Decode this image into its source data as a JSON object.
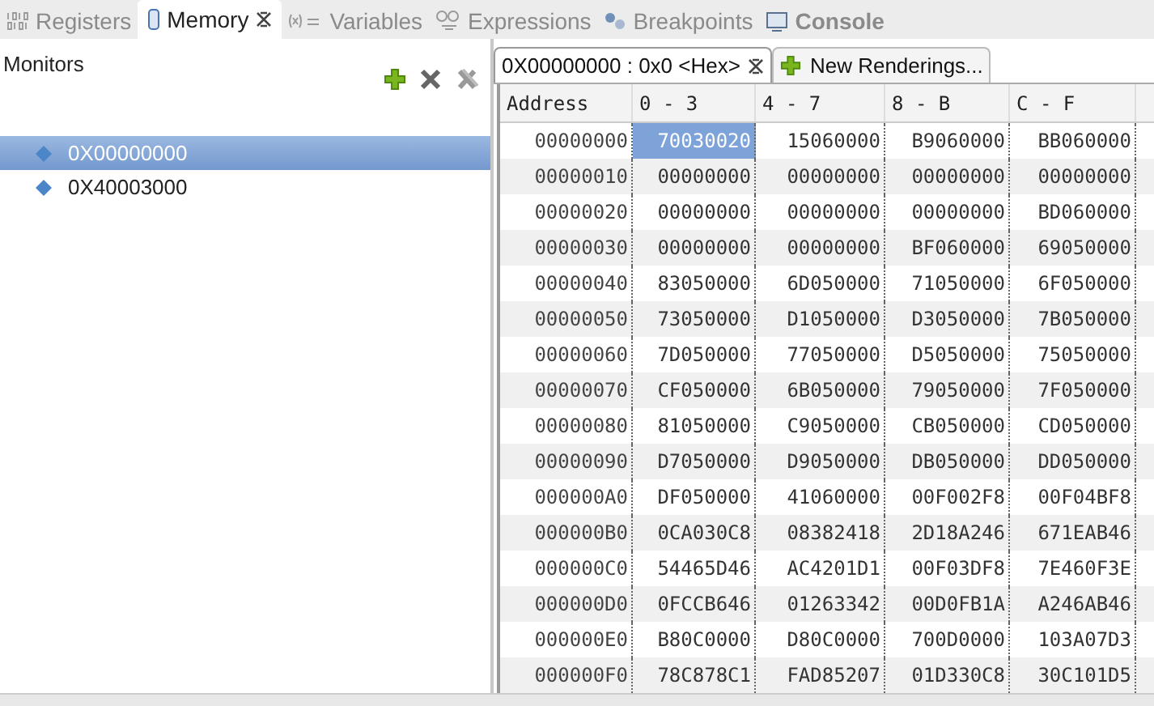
{
  "view_tabs": [
    {
      "kind": "registers",
      "label": "Registers",
      "selected": false,
      "emphasized": false,
      "closable": false
    },
    {
      "kind": "memory",
      "label": "Memory",
      "selected": true,
      "emphasized": false,
      "closable": true
    },
    {
      "kind": "variables",
      "label": "Variables",
      "selected": false,
      "emphasized": false,
      "closable": false
    },
    {
      "kind": "expressions",
      "label": "Expressions",
      "selected": false,
      "emphasized": false,
      "closable": false
    },
    {
      "kind": "breakpoints",
      "label": "Breakpoints",
      "selected": false,
      "emphasized": false,
      "closable": false
    },
    {
      "kind": "console",
      "label": "Console",
      "selected": false,
      "emphasized": true,
      "closable": false
    }
  ],
  "monitors": {
    "title": "Monitors",
    "items": [
      {
        "label": "0X00000000",
        "selected": true
      },
      {
        "label": "0X40003000",
        "selected": false
      }
    ]
  },
  "rendering_tabs": [
    {
      "kind": "rendering",
      "label": "0X00000000 : 0x0 <Hex>",
      "selected": true
    },
    {
      "kind": "new",
      "label": "New Renderings...",
      "selected": false
    }
  ],
  "table": {
    "address_header": "Address",
    "columns": [
      "0 - 3",
      "4 - 7",
      "8 - B",
      "C - F"
    ],
    "rows": [
      {
        "address": "00000000",
        "cells": [
          {
            "value": "70030020",
            "selected": true
          },
          {
            "value": "15060000",
            "selected": false
          },
          {
            "value": "B9060000",
            "selected": false
          },
          {
            "value": "BB060000",
            "selected": false
          }
        ]
      },
      {
        "address": "00000010",
        "cells": [
          {
            "value": "00000000",
            "selected": false
          },
          {
            "value": "00000000",
            "selected": false
          },
          {
            "value": "00000000",
            "selected": false
          },
          {
            "value": "00000000",
            "selected": false
          }
        ]
      },
      {
        "address": "00000020",
        "cells": [
          {
            "value": "00000000",
            "selected": false
          },
          {
            "value": "00000000",
            "selected": false
          },
          {
            "value": "00000000",
            "selected": false
          },
          {
            "value": "BD060000",
            "selected": false
          }
        ]
      },
      {
        "address": "00000030",
        "cells": [
          {
            "value": "00000000",
            "selected": false
          },
          {
            "value": "00000000",
            "selected": false
          },
          {
            "value": "BF060000",
            "selected": false
          },
          {
            "value": "69050000",
            "selected": false
          }
        ]
      },
      {
        "address": "00000040",
        "cells": [
          {
            "value": "83050000",
            "selected": false
          },
          {
            "value": "6D050000",
            "selected": false
          },
          {
            "value": "71050000",
            "selected": false
          },
          {
            "value": "6F050000",
            "selected": false
          }
        ]
      },
      {
        "address": "00000050",
        "cells": [
          {
            "value": "73050000",
            "selected": false
          },
          {
            "value": "D1050000",
            "selected": false
          },
          {
            "value": "D3050000",
            "selected": false
          },
          {
            "value": "7B050000",
            "selected": false
          }
        ]
      },
      {
        "address": "00000060",
        "cells": [
          {
            "value": "7D050000",
            "selected": false
          },
          {
            "value": "77050000",
            "selected": false
          },
          {
            "value": "D5050000",
            "selected": false
          },
          {
            "value": "75050000",
            "selected": false
          }
        ]
      },
      {
        "address": "00000070",
        "cells": [
          {
            "value": "CF050000",
            "selected": false
          },
          {
            "value": "6B050000",
            "selected": false
          },
          {
            "value": "79050000",
            "selected": false
          },
          {
            "value": "7F050000",
            "selected": false
          }
        ]
      },
      {
        "address": "00000080",
        "cells": [
          {
            "value": "81050000",
            "selected": false
          },
          {
            "value": "C9050000",
            "selected": false
          },
          {
            "value": "CB050000",
            "selected": false
          },
          {
            "value": "CD050000",
            "selected": false
          }
        ]
      },
      {
        "address": "00000090",
        "cells": [
          {
            "value": "D7050000",
            "selected": false
          },
          {
            "value": "D9050000",
            "selected": false
          },
          {
            "value": "DB050000",
            "selected": false
          },
          {
            "value": "DD050000",
            "selected": false
          }
        ]
      },
      {
        "address": "000000A0",
        "cells": [
          {
            "value": "DF050000",
            "selected": false
          },
          {
            "value": "41060000",
            "selected": false
          },
          {
            "value": "00F002F8",
            "selected": false
          },
          {
            "value": "00F04BF8",
            "selected": false
          }
        ]
      },
      {
        "address": "000000B0",
        "cells": [
          {
            "value": "0CA030C8",
            "selected": false
          },
          {
            "value": "08382418",
            "selected": false
          },
          {
            "value": "2D18A246",
            "selected": false
          },
          {
            "value": "671EAB46",
            "selected": false
          }
        ]
      },
      {
        "address": "000000C0",
        "cells": [
          {
            "value": "54465D46",
            "selected": false
          },
          {
            "value": "AC4201D1",
            "selected": false
          },
          {
            "value": "00F03DF8",
            "selected": false
          },
          {
            "value": "7E460F3E",
            "selected": false
          }
        ]
      },
      {
        "address": "000000D0",
        "cells": [
          {
            "value": "0FCCB646",
            "selected": false
          },
          {
            "value": "01263342",
            "selected": false
          },
          {
            "value": "00D0FB1A",
            "selected": false
          },
          {
            "value": "A246AB46",
            "selected": false
          }
        ]
      },
      {
        "address": "000000E0",
        "cells": [
          {
            "value": "B80C0000",
            "selected": false
          },
          {
            "value": "D80C0000",
            "selected": false
          },
          {
            "value": "700D0000",
            "selected": false
          },
          {
            "value": "103A07D3",
            "selected": false
          }
        ]
      },
      {
        "address": "000000F0",
        "cells": [
          {
            "value": "78C878C1",
            "selected": false
          },
          {
            "value": "FAD85207",
            "selected": false
          },
          {
            "value": "01D330C8",
            "selected": false
          },
          {
            "value": "30C101D5",
            "selected": false
          }
        ]
      }
    ]
  }
}
